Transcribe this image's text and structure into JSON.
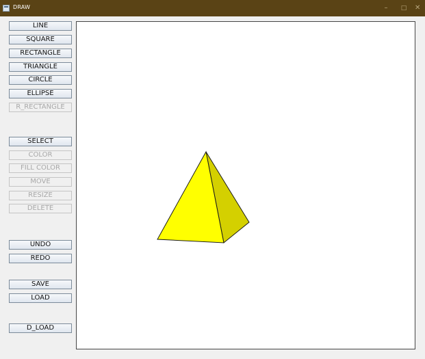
{
  "window": {
    "title": "DRAW",
    "minimize_glyph": "–",
    "maximize_glyph": "□",
    "close_glyph": "✕"
  },
  "toolbar": {
    "shapes": [
      {
        "label": "LINE",
        "enabled": true
      },
      {
        "label": "SQUARE",
        "enabled": true
      },
      {
        "label": "RECTANGLE",
        "enabled": true
      },
      {
        "label": "TRIANGLE",
        "enabled": true
      },
      {
        "label": "CIRCLE",
        "enabled": true
      },
      {
        "label": "ELLIPSE",
        "enabled": true
      },
      {
        "label": "R_RECTANGLE",
        "enabled": false
      }
    ],
    "edit": [
      {
        "label": "SELECT",
        "enabled": true
      },
      {
        "label": "COLOR",
        "enabled": false
      },
      {
        "label": "FILL COLOR",
        "enabled": false
      },
      {
        "label": "MOVE",
        "enabled": false
      },
      {
        "label": "RESIZE",
        "enabled": false
      },
      {
        "label": "DELETE",
        "enabled": false
      }
    ],
    "history": [
      {
        "label": "UNDO",
        "enabled": true
      },
      {
        "label": "REDO",
        "enabled": true
      }
    ],
    "file": [
      {
        "label": "SAVE",
        "enabled": true
      },
      {
        "label": "LOAD",
        "enabled": true
      }
    ],
    "extra": [
      {
        "label": "D_LOAD",
        "enabled": true
      }
    ]
  },
  "canvas": {
    "shape": "pyramid",
    "front_face_color": "#ffff00",
    "side_face_color": "#d4d000",
    "stroke_color": "#1a1a1a"
  }
}
